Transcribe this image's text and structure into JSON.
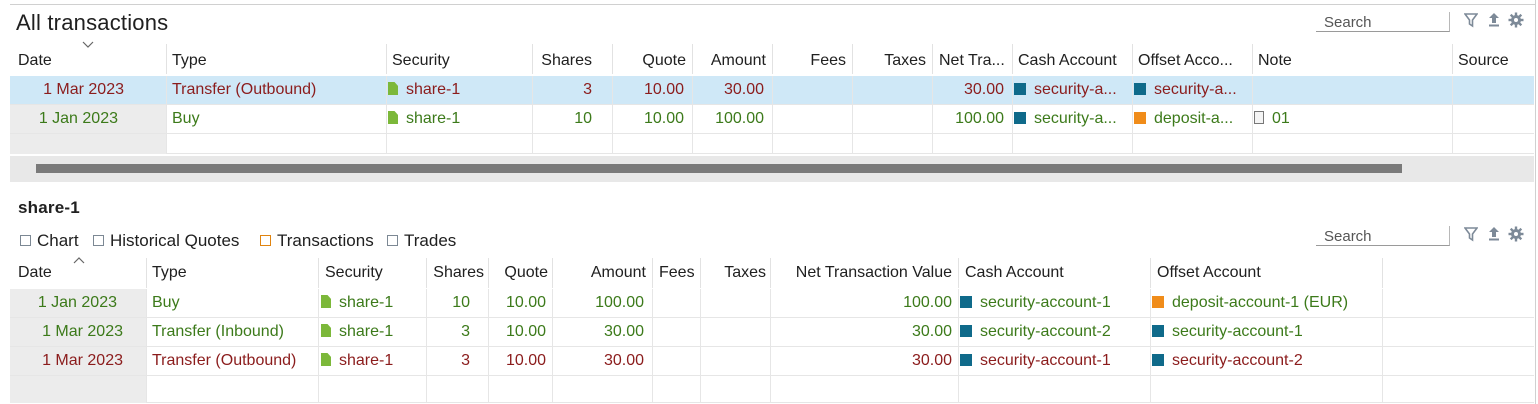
{
  "top_pane": {
    "title": "All transactions",
    "search_placeholder": "Search",
    "toolbar_icons": [
      "filter-icon",
      "export-icon",
      "settings-icon"
    ],
    "sort_indicator": "descending",
    "columns": [
      "Date",
      "Type",
      "Security",
      "Shares",
      "Quote",
      "Amount",
      "Fees",
      "Taxes",
      "Net Tra...",
      "Cash Account",
      "Offset Acco...",
      "Note",
      "Source"
    ],
    "rows": [
      {
        "selected": true,
        "tone": "red",
        "date": "1 Mar 2023",
        "type": "Transfer (Outbound)",
        "security": "share-1",
        "shares": "3",
        "quote": "10.00",
        "amount": "30.00",
        "fees": "",
        "taxes": "",
        "net": "30.00",
        "cash_account": "security-a...",
        "cash_icon": "account-icon",
        "offset_account": "security-a...",
        "offset_icon": "account-icon",
        "note": "",
        "source": ""
      },
      {
        "selected": false,
        "tone": "green",
        "date": "1 Jan 2023",
        "type": "Buy",
        "security": "share-1",
        "shares": "10",
        "quote": "10.00",
        "amount": "100.00",
        "fees": "",
        "taxes": "",
        "net": "100.00",
        "cash_account": "security-a...",
        "cash_icon": "account-icon",
        "offset_account": "deposit-a...",
        "offset_icon": "deposit-account-icon",
        "note": "01",
        "source": ""
      }
    ],
    "horizontal_scroll": {
      "thumb_fraction": 0.93,
      "position": 0.0
    }
  },
  "bottom_pane": {
    "title": "share-1",
    "tabs": [
      {
        "label": "Chart",
        "active": false
      },
      {
        "label": "Historical Quotes",
        "active": false
      },
      {
        "label": "Transactions",
        "active": true
      },
      {
        "label": "Trades",
        "active": false
      }
    ],
    "search_placeholder": "Search",
    "sort_indicator": "ascending",
    "columns": [
      "Date",
      "Type",
      "Security",
      "Shares",
      "Quote",
      "Amount",
      "Fees",
      "Taxes",
      "Net Transaction Value",
      "Cash Account",
      "Offset Account"
    ],
    "rows": [
      {
        "tone": "green",
        "date": "1 Jan 2023",
        "type": "Buy",
        "security": "share-1",
        "shares": "10",
        "quote": "10.00",
        "amount": "100.00",
        "fees": "",
        "taxes": "",
        "net": "100.00",
        "cash_account": "security-account-1",
        "cash_icon": "account-icon",
        "offset_account": "deposit-account-1 (EUR)",
        "offset_icon": "deposit-account-icon"
      },
      {
        "tone": "green",
        "date": "1 Mar 2023",
        "type": "Transfer (Inbound)",
        "security": "share-1",
        "shares": "3",
        "quote": "10.00",
        "amount": "30.00",
        "fees": "",
        "taxes": "",
        "net": "30.00",
        "cash_account": "security-account-2",
        "cash_icon": "account-icon",
        "offset_account": "security-account-1",
        "offset_icon": "account-icon"
      },
      {
        "tone": "red",
        "date": "1 Mar 2023",
        "type": "Transfer (Outbound)",
        "security": "share-1",
        "shares": "3",
        "quote": "10.00",
        "amount": "30.00",
        "fees": "",
        "taxes": "",
        "net": "30.00",
        "cash_account": "security-account-1",
        "cash_icon": "account-icon",
        "offset_account": "security-account-2",
        "offset_icon": "account-icon"
      }
    ]
  },
  "colors": {
    "row_red": "#8b1c1c",
    "row_green": "#3c7a1a",
    "selection": "#cfe8f7",
    "account_blue": "#0f6a8a",
    "deposit_orange": "#f08c1a",
    "security_green": "#7cb83a",
    "active_tab_orange": "#e08410"
  }
}
